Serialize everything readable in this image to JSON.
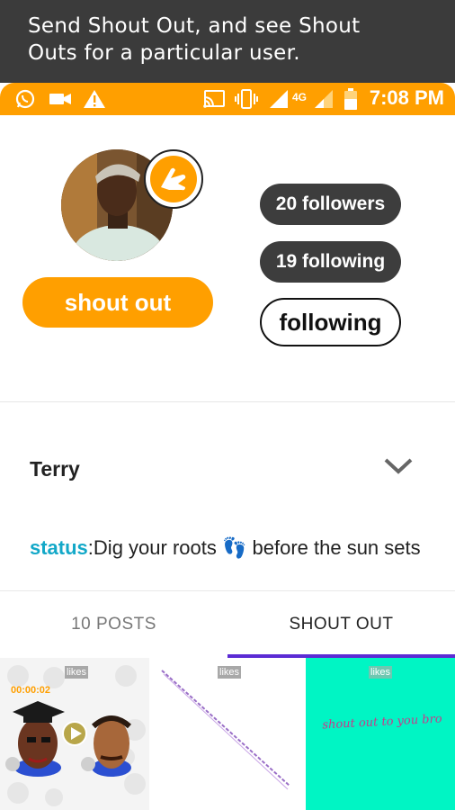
{
  "caption": {
    "line1": "Send Shout Out, and see Shout",
    "line2": "Outs for a particular user."
  },
  "statusbar": {
    "time": "7:08 PM",
    "network": "4G",
    "left_icons": [
      "whatsapp-icon",
      "video-camera-icon",
      "warning-icon"
    ],
    "right_icons": [
      "cast-icon",
      "vibrate-icon",
      "signal-icon",
      "signal-icon",
      "battery-icon"
    ]
  },
  "profile": {
    "shout_button": "shout out",
    "followers": "20 followers",
    "following_count": "19 following",
    "follow_state": "following",
    "accent_color": "#ff9f00"
  },
  "user": {
    "name": "Terry",
    "status_label": "status",
    "status_sep": ":",
    "status_text_1": "Dig your roots ",
    "status_emoji": "👣",
    "status_text_2": " before the sun sets"
  },
  "tabs": {
    "posts": "10 POSTS",
    "shout_out": "SHOUT OUT",
    "active": "SHOUT OUT",
    "indicator_color": "#5b2bd4"
  },
  "grid": [
    {
      "likes": "likes",
      "timer": "00:00:02",
      "kind": "video-avatars"
    },
    {
      "likes": "likes",
      "kind": "line-drawing"
    },
    {
      "likes": "likes",
      "text": "shout out to you bro",
      "bg": "#00f5c4",
      "kind": "text-card"
    }
  ]
}
